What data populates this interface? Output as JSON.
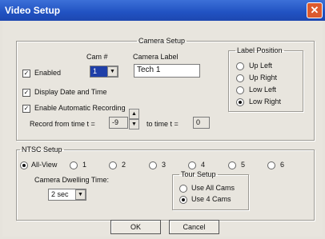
{
  "window": {
    "title": "Video Setup",
    "close_glyph": "✕"
  },
  "camera_setup": {
    "legend": "Camera Setup",
    "cam_num_label": "Cam #",
    "camera_label_label": "Camera Label",
    "enabled_label": "Enabled",
    "enabled_checked": true,
    "cam_num_value": "1",
    "camera_label_value": "Tech 1",
    "display_date_label": "Display Date and Time",
    "display_date_checked": true,
    "auto_record_label": "Enable Automatic Recording",
    "auto_record_checked": true,
    "record_from_label": "Record from time t =",
    "record_from_value": "-9",
    "to_time_label": "to time t =",
    "to_time_value": "0"
  },
  "label_position": {
    "legend": "Label Position",
    "options": [
      "Up Left",
      "Up Right",
      "Low Left",
      "Low Right"
    ],
    "selected": "Low Right"
  },
  "ntsc_setup": {
    "legend": "NTSC Setup",
    "views": [
      "All-View",
      "1",
      "2",
      "3",
      "4",
      "5",
      "6"
    ],
    "selected": "All-View",
    "dwelling_label": "Camera Dwelling Time:",
    "dwelling_value": "2 sec"
  },
  "tour_setup": {
    "legend": "Tour Setup",
    "options": [
      "Use All Cams",
      "Use 4 Cams"
    ],
    "selected": "Use 4 Cams"
  },
  "buttons": {
    "ok": "OK",
    "cancel": "Cancel"
  }
}
